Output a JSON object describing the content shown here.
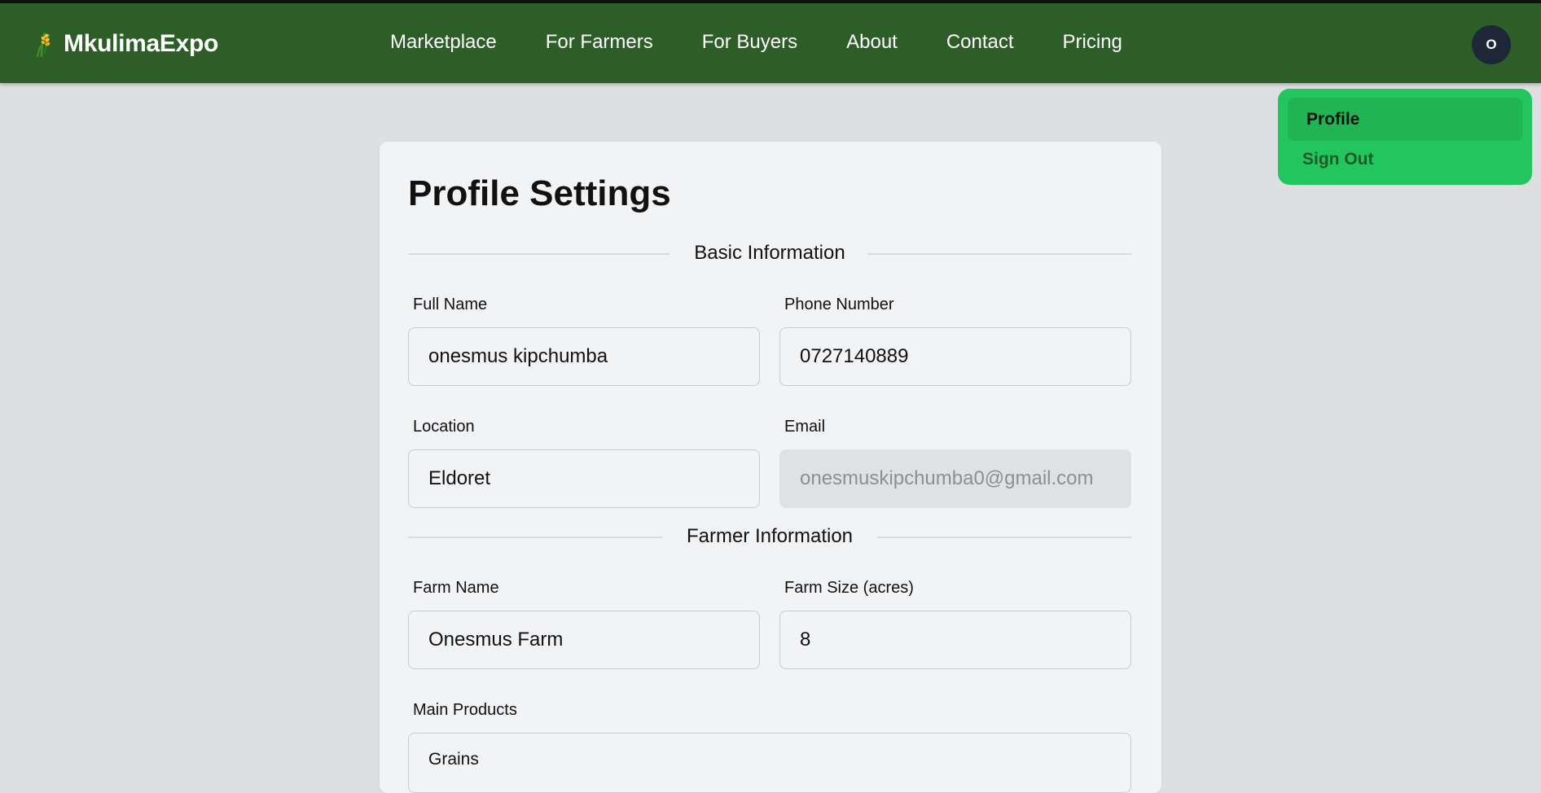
{
  "brand": {
    "name": "MkulimaExpo",
    "logo_icon": "wheat-icon"
  },
  "nav": {
    "links": [
      "Marketplace",
      "For Farmers",
      "For Buyers",
      "About",
      "Contact",
      "Pricing"
    ]
  },
  "user_menu": {
    "avatar_initial": "O",
    "items": [
      "Profile",
      "Sign Out"
    ]
  },
  "profile": {
    "title": "Profile Settings",
    "sections": {
      "basic": "Basic Information",
      "farmer": "Farmer Information"
    },
    "fields": {
      "full_name": {
        "label": "Full Name",
        "value": "onesmus kipchumba"
      },
      "phone": {
        "label": "Phone Number",
        "value": "0727140889"
      },
      "location": {
        "label": "Location",
        "value": "Eldoret"
      },
      "email": {
        "label": "Email",
        "value": "onesmuskipchumba0@gmail.com"
      },
      "farm_name": {
        "label": "Farm Name",
        "value": "Onesmus Farm"
      },
      "farm_size": {
        "label": "Farm Size (acres)",
        "value": "8"
      },
      "main_products": {
        "label": "Main Products",
        "value": "Grains"
      }
    }
  },
  "colors": {
    "navbar": "#2e5e27",
    "dropdown": "#22c55e",
    "dropdown_active": "#20b453",
    "avatar": "#1e2738",
    "page_bg": "#dedfe1",
    "card_bg": "#f2f3f5"
  }
}
